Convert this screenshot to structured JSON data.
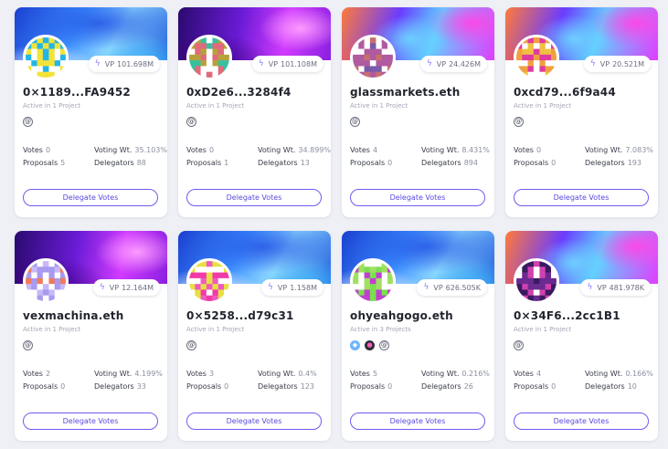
{
  "vp_label": "VP",
  "labels": {
    "votes": "Votes",
    "voting_wt": "Voting Wt.",
    "proposals": "Proposals",
    "delegators": "Delegators"
  },
  "cards": [
    {
      "name": "0×1189...FA9452",
      "active": "Active in 1 Project",
      "vp": "101.698M",
      "votes": "0",
      "voting_wt": "35.103%",
      "proposals": "5",
      "delegators": "88",
      "button": "Delegate Votes",
      "banner": "wave",
      "protocols": [
        "ens-icon"
      ],
      "avatar_colors": [
        "#f2e33a",
        "#22b6e8",
        "#f2e33a"
      ]
    },
    {
      "name": "0xD2e6...3284f4",
      "active": "Active in 1 Project",
      "vp": "101.108M",
      "votes": "0",
      "voting_wt": "34.899%",
      "proposals": "1",
      "delegators": "13",
      "button": "Delegate Votes",
      "banner": "purple",
      "protocols": [
        "ens-icon"
      ],
      "avatar_colors": [
        "#36c0a0",
        "#b6a23a",
        "#e06a7a"
      ]
    },
    {
      "name": "glassmarkets.eth",
      "active": "Active in 1 Project",
      "vp": "24.426M",
      "votes": "4",
      "voting_wt": "8.431%",
      "proposals": "0",
      "delegators": "894",
      "button": "Delegate Votes",
      "banner": "mixed",
      "protocols": [
        "ens-icon"
      ],
      "avatar_colors": [
        "#c8706a",
        "#7a5aa8",
        "#b05aa0"
      ]
    },
    {
      "name": "0xcd79...6f9a44",
      "active": "Active in 1 Project",
      "vp": "20.521M",
      "votes": "0",
      "voting_wt": "7.083%",
      "proposals": "0",
      "delegators": "193",
      "button": "Delegate Votes",
      "banner": "mixed",
      "protocols": [
        "ens-icon"
      ],
      "avatar_colors": [
        "#f0a040",
        "#e03aa0",
        "#f0c040"
      ]
    },
    {
      "name": "vexmachina.eth",
      "active": "Active in 1 Project",
      "vp": "12.164M",
      "votes": "2",
      "voting_wt": "4.199%",
      "proposals": "0",
      "delegators": "33",
      "button": "Delegate Votes",
      "banner": "purple",
      "protocols": [
        "ens-icon"
      ],
      "avatar_colors": [
        "#a89af0",
        "#f07a5a",
        "#c8b8f8"
      ]
    },
    {
      "name": "0×5258...d79c31",
      "active": "Active in 1 Project",
      "vp": "1.158M",
      "votes": "3",
      "voting_wt": "0.4%",
      "proposals": "0",
      "delegators": "123",
      "button": "Delegate Votes",
      "banner": "wave",
      "protocols": [
        "ens-icon"
      ],
      "avatar_colors": [
        "#f03aa8",
        "#e8e040",
        "#f05ac0"
      ]
    },
    {
      "name": "ohyeahgogo.eth",
      "active": "Active in 3 Projects",
      "vp": "626.505K",
      "votes": "5",
      "voting_wt": "0.216%",
      "proposals": "0",
      "delegators": "26",
      "button": "Delegate Votes",
      "banner": "wave",
      "protocols": [
        "blue-protocol-icon",
        "dark-protocol-icon",
        "ens-icon"
      ],
      "avatar_colors": [
        "#7ae050",
        "#c040d0",
        "#a0e060"
      ]
    },
    {
      "name": "0×34F6...2cc1B1",
      "active": "Active in 1 Project",
      "vp": "481.978K",
      "votes": "4",
      "voting_wt": "0.166%",
      "proposals": "0",
      "delegators": "10",
      "button": "Delegate Votes",
      "banner": "mixed",
      "protocols": [
        "ens-icon"
      ],
      "avatar_colors": [
        "#6a2a90",
        "#d040b0",
        "#3a1a60"
      ]
    }
  ]
}
